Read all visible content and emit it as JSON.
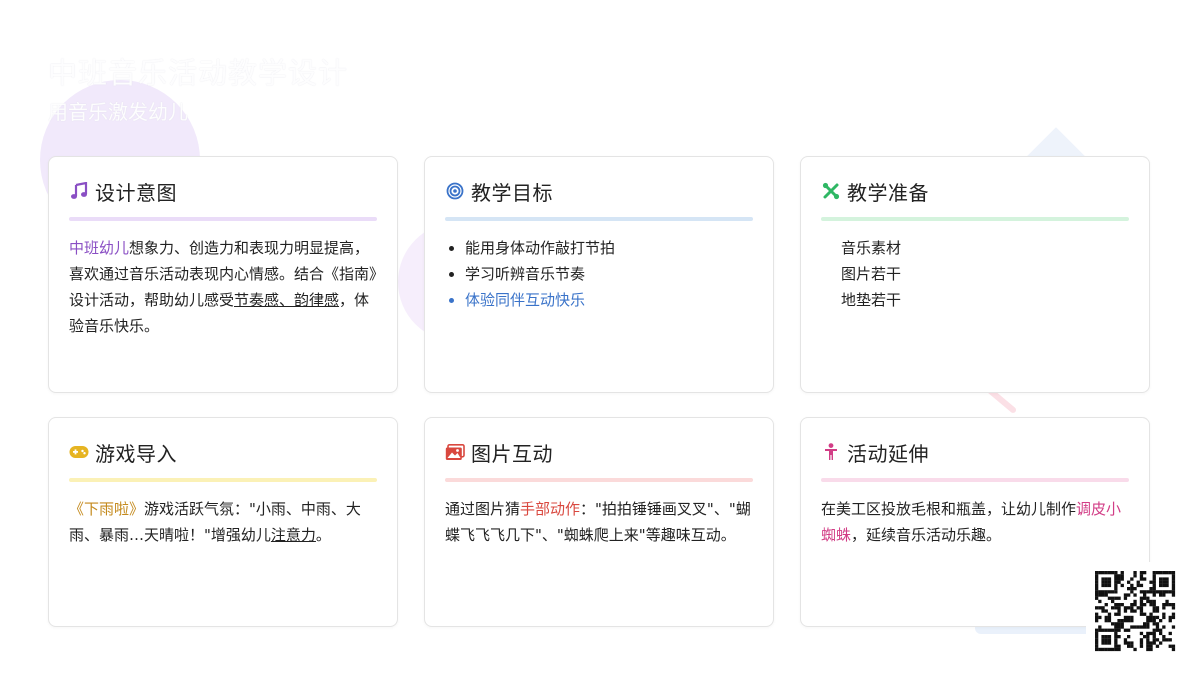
{
  "header": {
    "title": "中班音乐活动教学设计",
    "subtitle": "用音乐激发幼儿"
  },
  "cards": {
    "design_intent": {
      "title": "设计意图",
      "icon": "music-note-icon",
      "accent": "#8a4fc4",
      "divider_color": "#eadcf8",
      "highlight": "中班幼儿",
      "text_a": "想象力、创造力和表现力明显提高，喜欢通过音乐活动表现内心情感。结合《指南》设计活动，帮助幼儿感受",
      "underlined": "节奏感、韵律感",
      "text_b": "，体验音乐快乐。"
    },
    "goals": {
      "title": "教学目标",
      "icon": "target-icon",
      "accent": "#3a73c9",
      "divider_color": "#d5e5f5",
      "items": [
        "能用身体动作敲打节拍",
        "学习听辨音乐节奏",
        "体验同伴互动快乐"
      ]
    },
    "preparation": {
      "title": "教学准备",
      "icon": "tools-icon",
      "accent": "#2fb764",
      "divider_color": "#d4f3dd",
      "items": [
        "音乐素材",
        "图片若干",
        "地垫若干"
      ]
    },
    "game_intro": {
      "title": "游戏导入",
      "icon": "gamepad-icon",
      "accent": "#e6b422",
      "divider_color": "#fbf1b6",
      "highlight": "《下雨啦》",
      "text_a": "游戏活跃气氛：\"小雨、中雨、大雨、暴雨…天晴啦！\"增强幼儿",
      "underlined": "注意力",
      "text_b": "。"
    },
    "picture_interaction": {
      "title": "图片互动",
      "icon": "image-icon",
      "accent": "#d9483f",
      "divider_color": "#fbdada",
      "text_a": "通过图片猜",
      "highlight": "手部动作",
      "text_b": "：\"拍拍锤锤画叉叉\"、\"蝴蝶飞飞飞几下\"、\"蜘蛛爬上来\"等趣味互动。"
    },
    "extension": {
      "title": "活动延伸",
      "icon": "child-icon",
      "accent": "#d23d86",
      "divider_color": "#f9dbea",
      "text_a": "在美工区投放毛根和瓶盖，让幼儿制作",
      "highlight": "调皮小蜘蛛",
      "text_b": "，延续音乐活动乐趣。"
    }
  },
  "qr": {
    "icon": "qr-code-icon"
  }
}
